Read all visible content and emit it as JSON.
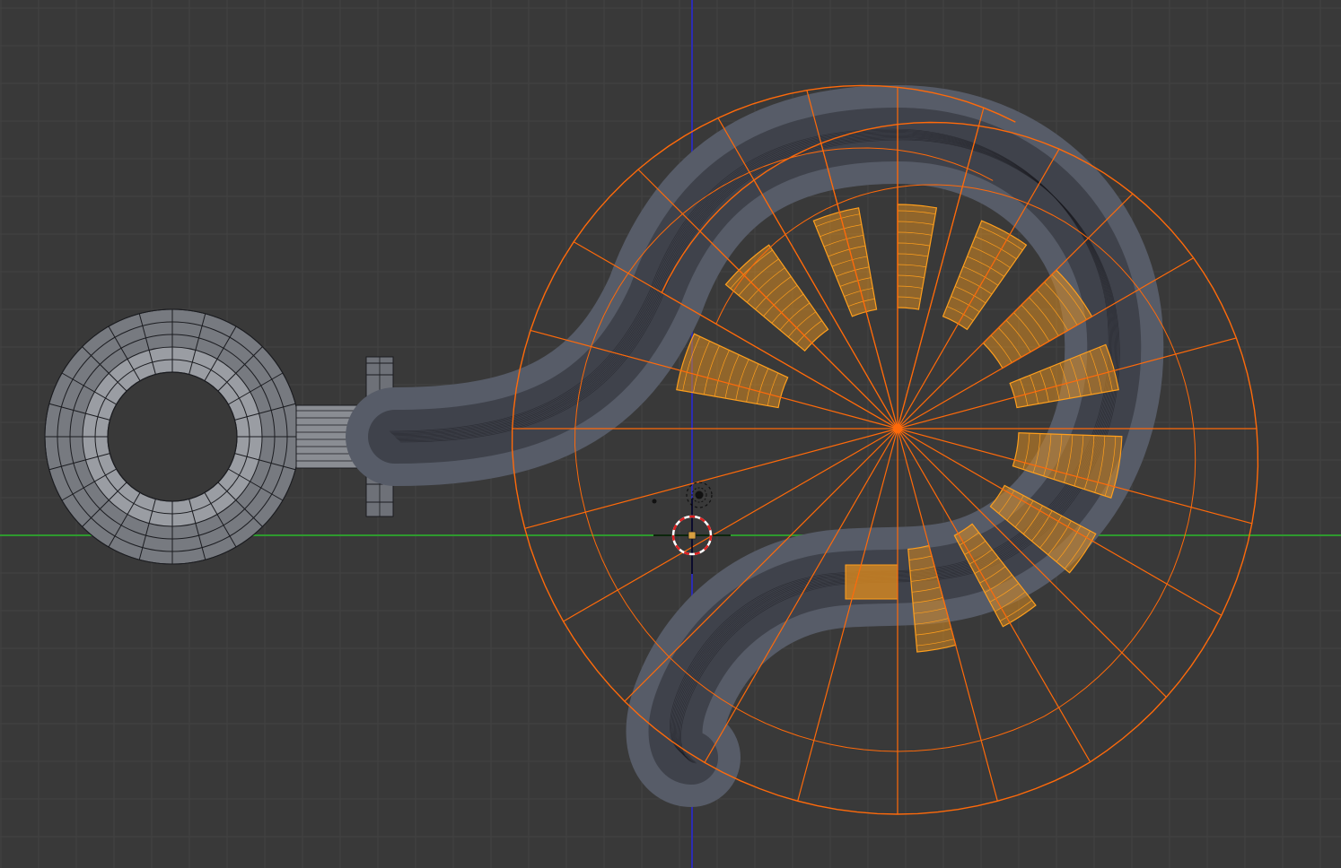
{
  "viewport": {
    "background": "#393939",
    "grid_color": "#434343",
    "x_axis_color": "#2e9a2e",
    "y_axis_color": "#2c2cb4"
  },
  "colors": {
    "mesh_dark": "#35383f",
    "mesh_mid": "#575c68",
    "mesh_light": "#7a7f8c",
    "wire": "#1b1c20",
    "ring_body": "#777a80",
    "ring_light": "#9a9da3",
    "selection": "#ff9f1c",
    "selection_fill": "#d98a20",
    "active": "#ff6a0a",
    "cursor_red": "#e02020",
    "cursor_white": "#ffffff"
  },
  "objects": {
    "eye_ring": "torus-eye",
    "shank": "hook-shank",
    "collar": "hex-collar",
    "hook": "hook-body",
    "spin_guide": "spin-gizmo",
    "cursor": "3d-cursor",
    "lamp": "lamp-icon"
  }
}
